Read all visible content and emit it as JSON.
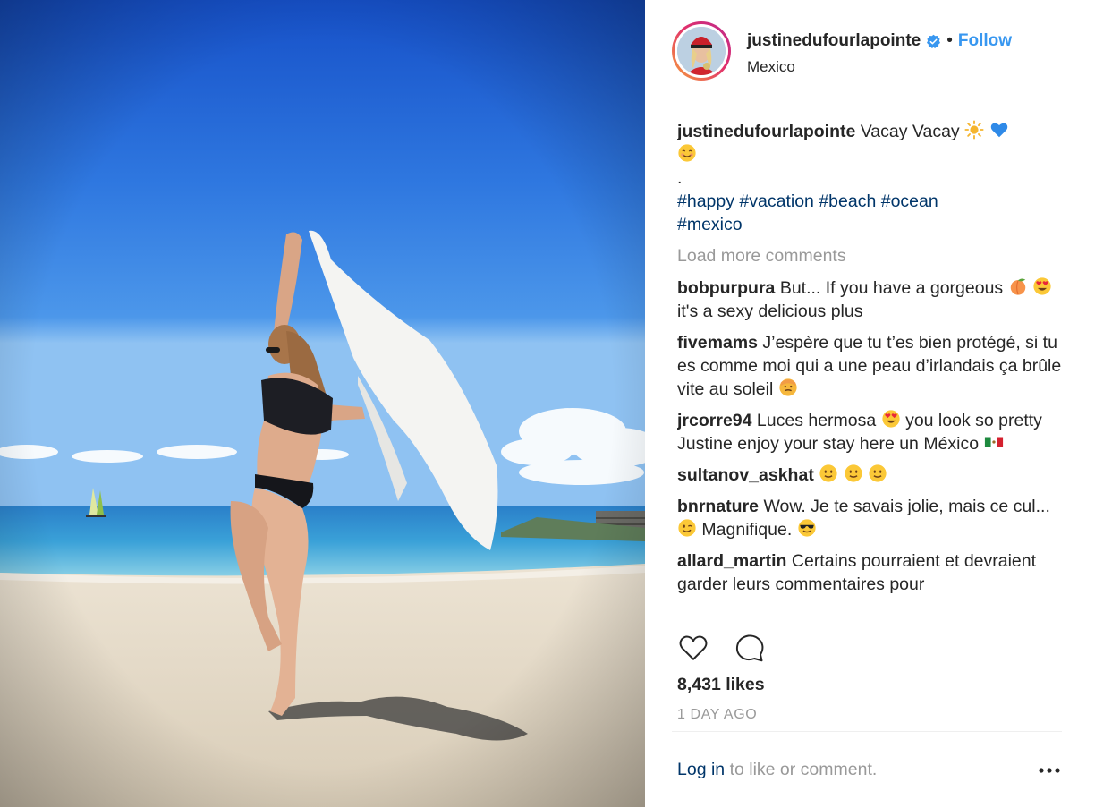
{
  "post": {
    "username": "justinedufourlapointe",
    "follow_label": "Follow",
    "separator": "•",
    "location": "Mexico"
  },
  "caption": {
    "username": "justinedufourlapointe",
    "text": "Vacay Vacay",
    "emojis": [
      "sun-icon",
      "blue-heart-icon",
      "smiling-face-icon"
    ],
    "dot": ".",
    "hashtags": [
      "#happy",
      "#vacation",
      "#beach",
      "#ocean",
      "#mexico"
    ]
  },
  "load_more_label": "Load more comments",
  "comments": [
    {
      "user": "bobpurpura",
      "t1": "But... If you have a gorgeous",
      "t2": "it's a sexy delicious plus",
      "emojis": [
        "peach-icon",
        "heart-eyes-icon"
      ]
    },
    {
      "user": "fivemams",
      "t1": "J’espère que tu t’es bien protégé, si tu es comme moi qui a une peau d’irlandais ça brûle vite au soleil",
      "emojis": [
        "hot-face-icon"
      ]
    },
    {
      "user": "jrcorre94",
      "t1": "Luces hermosa",
      "t2": "you look so pretty Justine enjoy your stay here un México",
      "emojis": [
        "heart-eyes-icon",
        "mexico-flag-icon"
      ]
    },
    {
      "user": "sultanov_askhat",
      "t1": "",
      "emojis": [
        "slight-smile-icon",
        "slight-smile-icon",
        "slight-smile-icon"
      ]
    },
    {
      "user": "bnrnature",
      "t1": "Wow. Je te savais jolie, mais ce cul...",
      "t2": "Magnifique.",
      "emojis": [
        "wink-icon",
        "sunglasses-face-icon"
      ]
    },
    {
      "user": "allard_martin",
      "t1": "Certains pourraient et devraient garder leurs commentaires pour"
    }
  ],
  "likes_text": "8,431 likes",
  "time_text": "1 DAY AGO",
  "footer": {
    "login_label": "Log in",
    "login_rest": "to like or comment."
  },
  "colors": {
    "accent": "#3897f0",
    "link": "#003569",
    "muted": "#999999",
    "text": "#262626"
  },
  "icons": [
    "heart-outline-icon",
    "comment-bubble-icon",
    "more-options-icon",
    "verified-badge-icon"
  ]
}
